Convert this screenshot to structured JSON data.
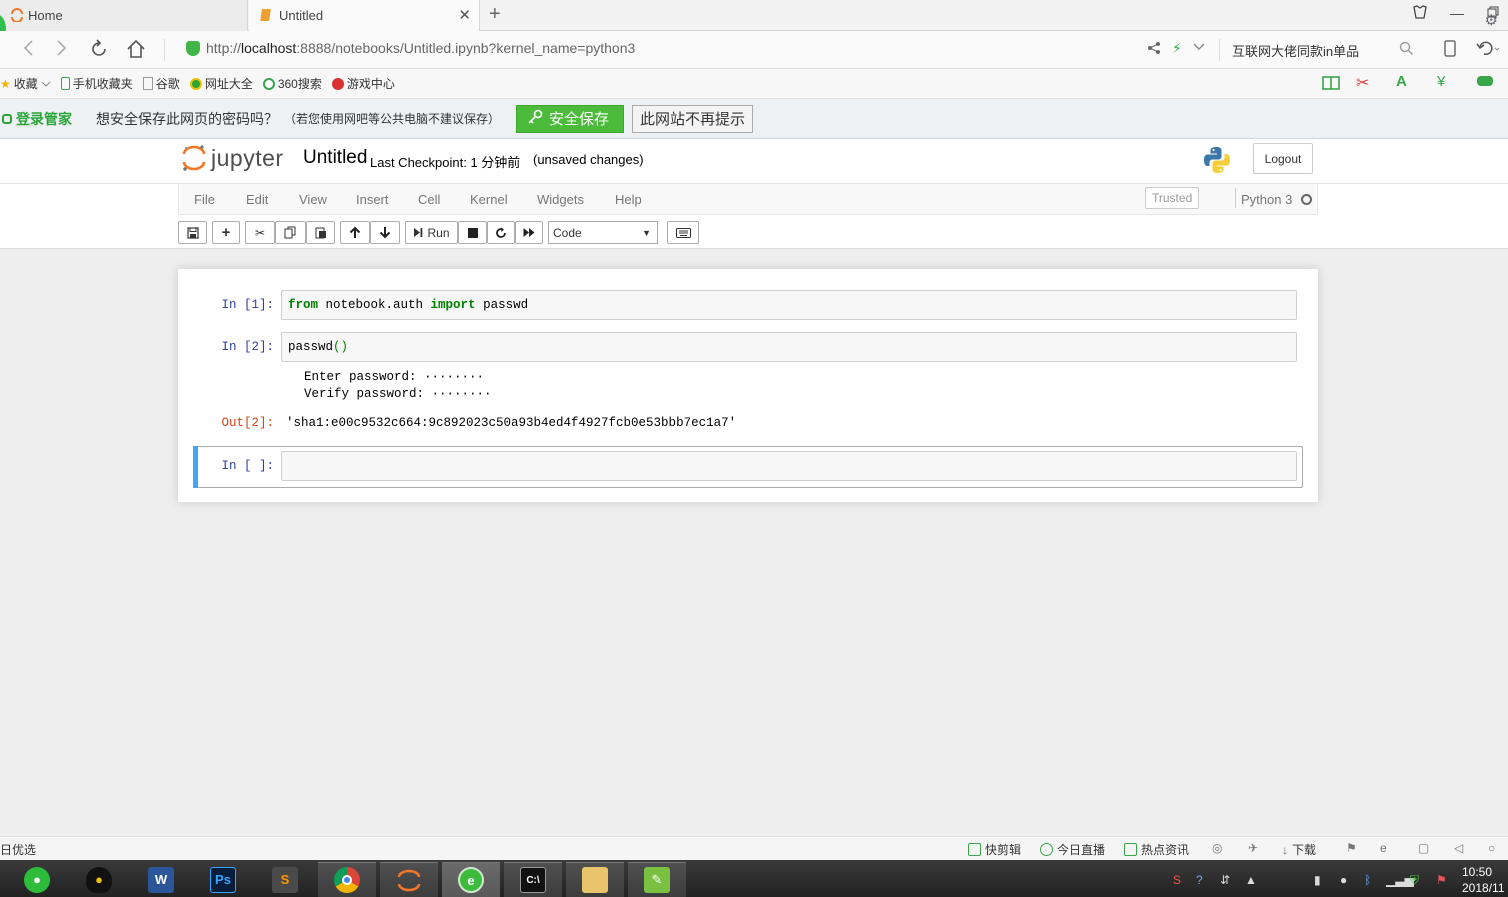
{
  "browser": {
    "tabs": [
      {
        "label": "Home",
        "active": false
      },
      {
        "label": "Untitled",
        "active": true
      }
    ],
    "address": {
      "scheme": "http://",
      "host": "localhost",
      "path": ":8888/notebooks/Untitled.ipynb?kernel_name=python3"
    },
    "search_hint": "互联网大佬同款in单品",
    "bookmarks": [
      "收藏",
      "手机收藏夹",
      "谷歌",
      "网址大全",
      "360搜索",
      "游戏中心"
    ],
    "password_bar": {
      "brand": "登录管家",
      "question": "想安全保存此网页的密码吗？",
      "note": "（若您使用网吧等公共电脑不建议保存）",
      "save_label": "安全保存",
      "never_label": "此网站不再提示"
    }
  },
  "jupyter": {
    "logo_text": "jupyter",
    "notebook_title": "Untitled",
    "checkpoint": "Last Checkpoint: 1 分钟前",
    "unsaved": "(unsaved changes)",
    "logout_label": "Logout",
    "menu": [
      "File",
      "Edit",
      "View",
      "Insert",
      "Cell",
      "Kernel",
      "Widgets",
      "Help"
    ],
    "trusted_label": "Trusted",
    "kernel_name": "Python 3",
    "toolbar": {
      "run_label": "Run",
      "cell_type": "Code"
    },
    "cells": [
      {
        "prompt": "In [1]:",
        "code_kw1": "from",
        "code_mid": " notebook.auth ",
        "code_kw2": "import",
        "code_end": " passwd"
      },
      {
        "prompt": "In [2]:",
        "code_fn": "passwd",
        "code_parens": "()",
        "stdout": [
          "Enter password: ········",
          "Verify password: ········"
        ],
        "out_prompt": "Out[2]:",
        "out_value": "'sha1:e00c9532c664:9c892023c50a93b4ed4f4927fcb0e53bbb7ec1a7'"
      },
      {
        "prompt": "In [ ]:",
        "code": ""
      }
    ]
  },
  "statusbar": {
    "left": "日优选",
    "items": [
      "快剪辑",
      "今日直播",
      "热点资讯",
      "下载"
    ]
  },
  "taskbar": {
    "clock_time": "10:50",
    "clock_date": "2018/11"
  }
}
